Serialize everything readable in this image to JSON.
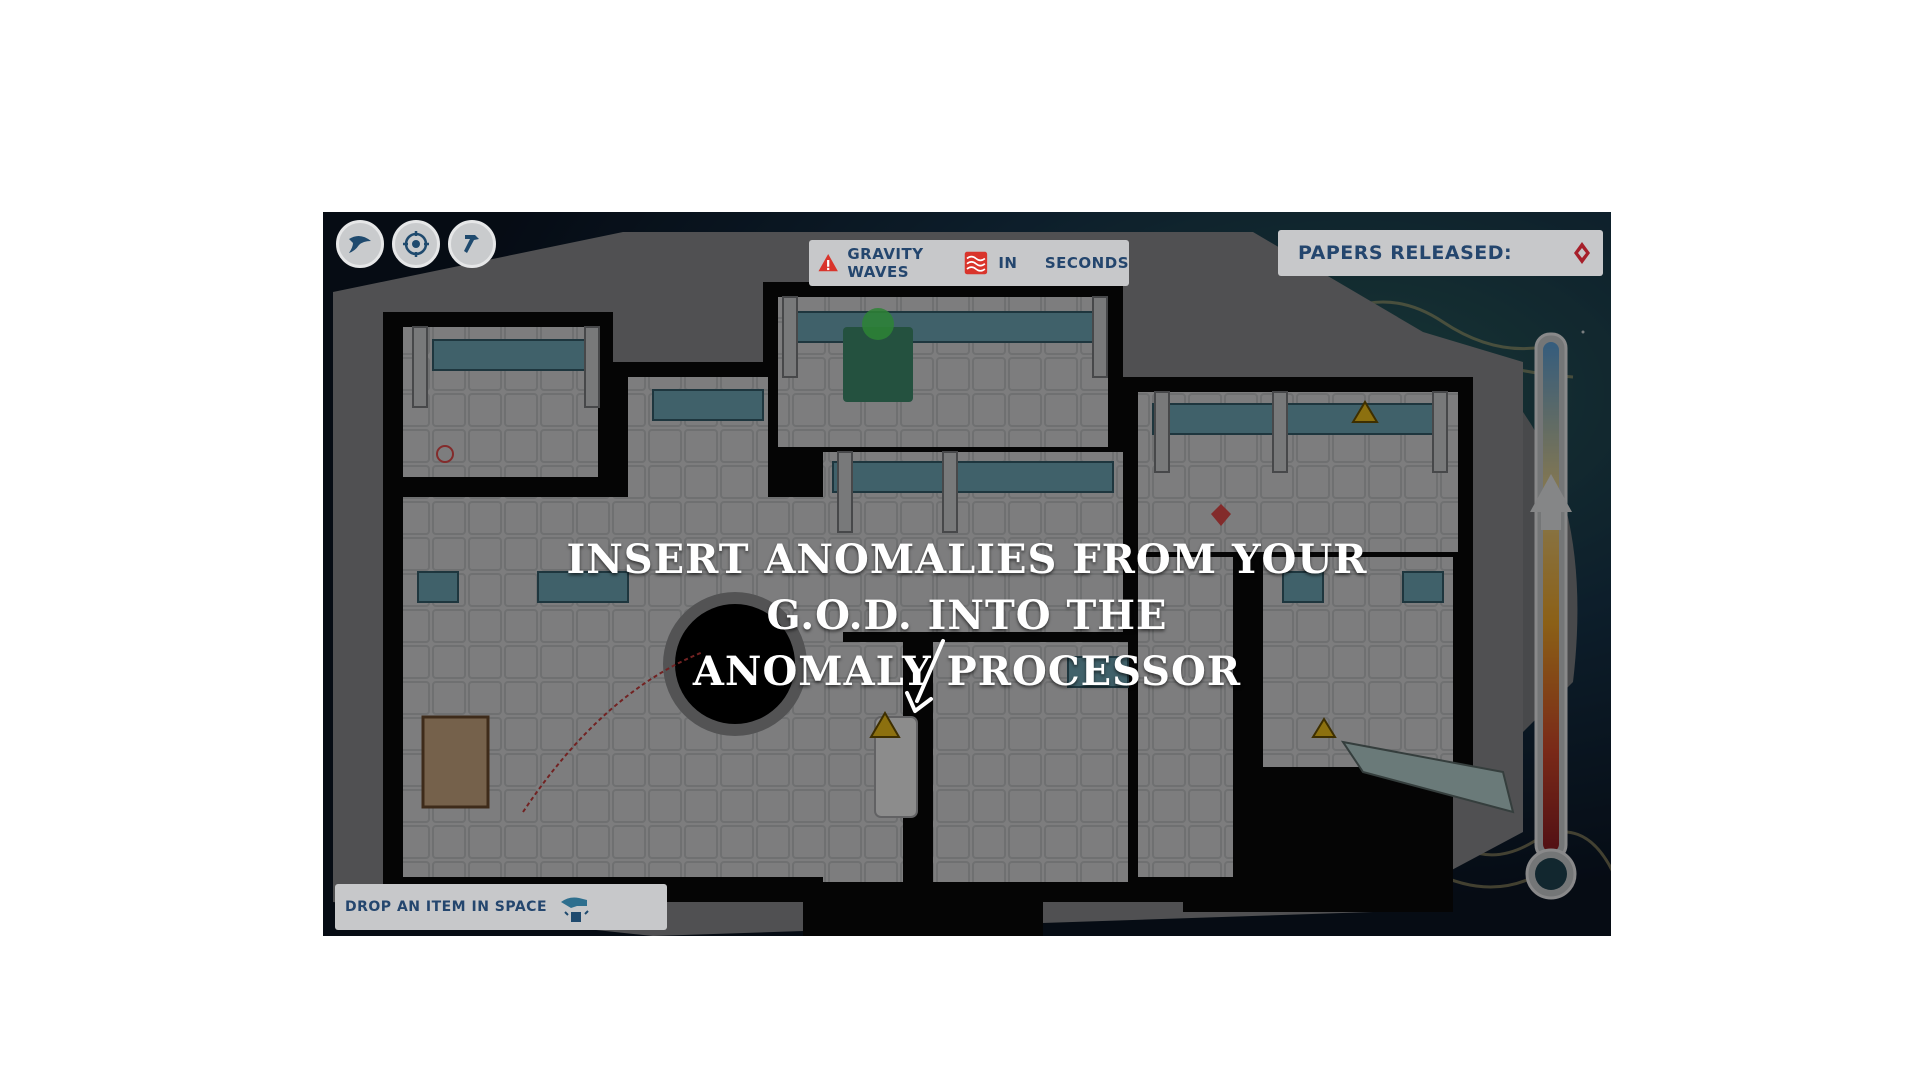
{
  "toolbar": {
    "buttons": [
      {
        "icon": "wing-icon"
      },
      {
        "icon": "compass-icon"
      },
      {
        "icon": "hammer-icon"
      }
    ]
  },
  "hazard": {
    "icon": "warning-icon",
    "label": "GRAVITY WAVES",
    "wave_icon": "gravity-wave-icon",
    "in_label": "IN",
    "seconds_value": "",
    "seconds_label": "SECONDS"
  },
  "papers": {
    "label": "PAPERS RELEASED:",
    "value_icon": "diamond-icon"
  },
  "tutorial": {
    "line1": "INSERT ANOMALIES FROM YOUR G.O.D. INTO THE",
    "line2": "ANOMALY PROCESSOR"
  },
  "drop": {
    "label": "DROP AN ITEM IN SPACE",
    "icon": "hand-drop-icon"
  },
  "colors": {
    "banner_bg": "#c7c8ca",
    "banner_text": "#24466e",
    "warning": "#d9342b",
    "meter_top": "#5b9fd8",
    "meter_bottom": "#b3262b"
  }
}
